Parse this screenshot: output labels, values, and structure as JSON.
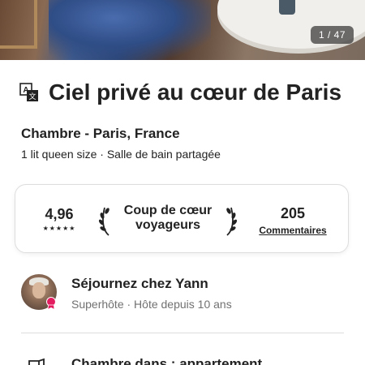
{
  "hero": {
    "photo_counter": "1 / 47"
  },
  "listing": {
    "title": "Ciel privé au cœur de Paris",
    "subtitle": "Chambre - Paris, France",
    "details": "1 lit queen size · Salle de bain partagée"
  },
  "stats": {
    "rating": "4,96",
    "stars": "★★★★★",
    "guest_favorite_line1": "Coup de cœur",
    "guest_favorite_line2": "voyageurs",
    "reviews_count": "205",
    "reviews_label": "Commentaires"
  },
  "host": {
    "name": "Séjournez chez Yann",
    "subtitle": "Superhôte · Hôte depuis 10 ans",
    "badge_color": "#E31C5F"
  },
  "next_section": {
    "text": "Chambre dans : appartement"
  },
  "icons": {
    "translate": "translate-icon",
    "laurel": "laurel-icon",
    "superhost": "superhost-badge-icon",
    "room": "door-icon"
  }
}
